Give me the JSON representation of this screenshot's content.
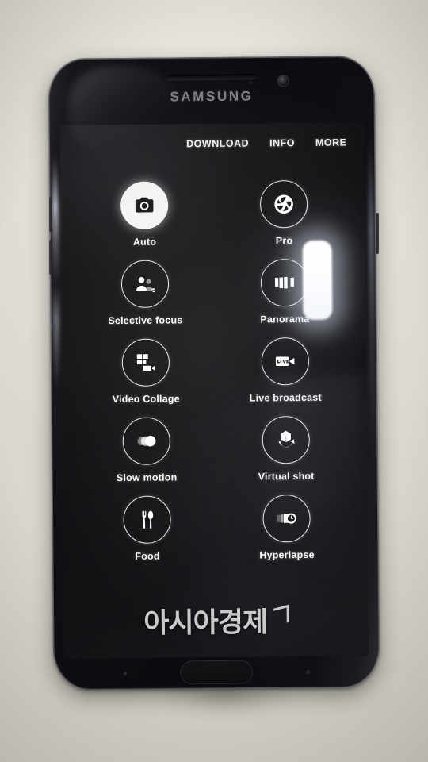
{
  "scene": {
    "device_brand": "SAMSUNG",
    "background_color": "#e4e2da",
    "phone_color": "#0c0c10"
  },
  "screen": {
    "top_menu": [
      {
        "label": "DOWNLOAD",
        "name": "menu-download"
      },
      {
        "label": "INFO",
        "name": "menu-info"
      },
      {
        "label": "MORE",
        "name": "menu-more"
      }
    ],
    "modes": [
      {
        "label": "Auto",
        "icon": "camera-icon",
        "selected": true
      },
      {
        "label": "Pro",
        "icon": "aperture-icon",
        "selected": false
      },
      {
        "label": "Selective focus",
        "icon": "selective-focus-icon",
        "selected": false
      },
      {
        "label": "Panorama",
        "icon": "panorama-icon",
        "selected": false
      },
      {
        "label": "Video Collage",
        "icon": "video-collage-icon",
        "selected": false
      },
      {
        "label": "Live broadcast",
        "icon": "live-broadcast-icon",
        "selected": false
      },
      {
        "label": "Slow motion",
        "icon": "slow-motion-icon",
        "selected": false
      },
      {
        "label": "Virtual shot",
        "icon": "virtual-shot-icon",
        "selected": false
      },
      {
        "label": "Food",
        "icon": "food-icon",
        "selected": false
      },
      {
        "label": "Hyperlapse",
        "icon": "hyperlapse-icon",
        "selected": false
      }
    ],
    "watermark": {
      "text": "아시아경제",
      "color": "#c9c9cb"
    }
  }
}
